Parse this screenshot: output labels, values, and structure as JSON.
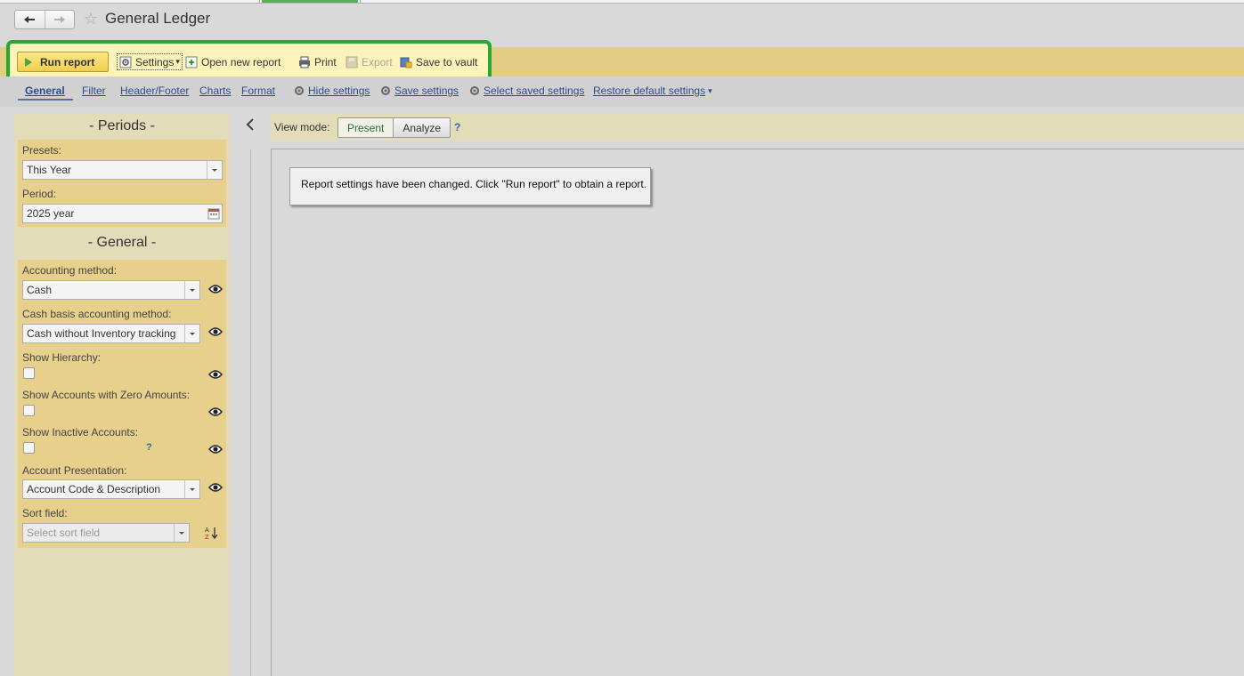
{
  "window": {
    "title": "General Ledger"
  },
  "toolbar": {
    "run_report": "Run report",
    "settings": "Settings",
    "open_new_report": "Open new report",
    "print": "Print",
    "export": "Export",
    "save_to_vault": "Save to vault"
  },
  "tabs": {
    "general": "General",
    "filter": "Filter",
    "header_footer": "Header/Footer",
    "charts": "Charts",
    "format": "Format"
  },
  "settings_links": {
    "hide": "Hide settings",
    "save": "Save settings",
    "select_saved": "Select saved settings",
    "restore_default": "Restore default settings"
  },
  "periods": {
    "title": "- Periods -",
    "presets_label": "Presets:",
    "presets_value": "This Year",
    "period_label": "Period:",
    "period_value": "2025 year"
  },
  "general": {
    "title": "- General -",
    "accounting_method_label": "Accounting method:",
    "accounting_method_value": "Cash",
    "cash_basis_label": "Cash basis accounting method:",
    "cash_basis_value": "Cash without Inventory tracking",
    "show_hierarchy_label": "Show Hierarchy:",
    "show_zero_label": "Show Accounts with Zero Amounts:",
    "show_inactive_label": "Show Inactive Accounts:",
    "help": "?",
    "account_presentation_label": "Account Presentation:",
    "account_presentation_value": "Account Code & Description",
    "sort_field_label": "Sort field:",
    "sort_field_placeholder": "Select sort field"
  },
  "view_mode": {
    "label": "View mode:",
    "present": "Present",
    "analyze": "Analyze",
    "help": "?"
  },
  "message": "Report settings have been changed. Click \"Run report\" to obtain a report.",
  "colors": {
    "highlight_border": "#27a830",
    "command_bar": "#e3cd82",
    "settings_group": "#e6d08b",
    "link": "#2a4d8f"
  }
}
